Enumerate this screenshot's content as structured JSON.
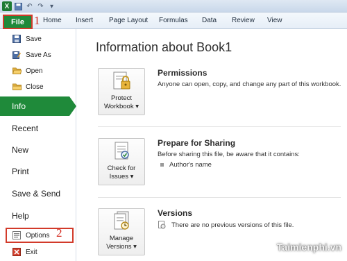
{
  "qat": {
    "logo": "X"
  },
  "ribbon": {
    "file_label": "File",
    "tabs": [
      "Home",
      "Insert",
      "Page Layout",
      "Formulas",
      "Data",
      "Review",
      "View"
    ]
  },
  "annotations": {
    "step1": "1",
    "step2": "2"
  },
  "nav": {
    "small_items": [
      {
        "label": "Save",
        "icon": "save-icon"
      },
      {
        "label": "Save As",
        "icon": "save-as-icon"
      },
      {
        "label": "Open",
        "icon": "open-folder-icon"
      },
      {
        "label": "Close",
        "icon": "close-folder-icon"
      }
    ],
    "info": "Info",
    "recent": "Recent",
    "new": "New",
    "print": "Print",
    "save_send": "Save & Send",
    "help": "Help",
    "options": "Options",
    "exit": "Exit"
  },
  "main": {
    "title": "Information about Book1",
    "permissions": {
      "button": "Protect Workbook",
      "heading": "Permissions",
      "desc": "Anyone can open, copy, and change any part of this workbook."
    },
    "sharing": {
      "button": "Check for Issues",
      "heading": "Prepare for Sharing",
      "desc": "Before sharing this file, be aware that it contains:",
      "bullet": "Author's name"
    },
    "versions": {
      "button": "Manage Versions",
      "heading": "Versions",
      "desc": "There are no previous versions of this file."
    }
  },
  "watermark": "Taimienphi.vn",
  "colors": {
    "accent": "#1f8a3a",
    "highlight": "#d23a2a"
  }
}
